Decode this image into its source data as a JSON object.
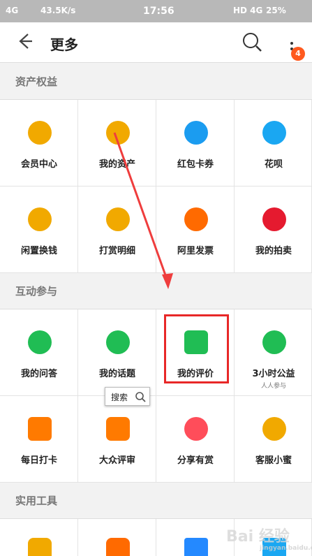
{
  "status_bar": {
    "signal": "4G",
    "speed": "43.5K/s",
    "time": "17:56",
    "network": "HD 4G",
    "battery": "25%"
  },
  "header": {
    "title": "更多",
    "badge": "4"
  },
  "sections": [
    {
      "title": "资产权益",
      "items": [
        {
          "label": "会员中心",
          "icon": "member-center-icon",
          "color": "#f1a900"
        },
        {
          "label": "我的资产",
          "icon": "assets-icon",
          "color": "#f1a900"
        },
        {
          "label": "红包卡券",
          "icon": "coupon-icon",
          "color": "#1b9cf0"
        },
        {
          "label": "花呗",
          "icon": "huabei-icon",
          "color": "#1aa7f2"
        },
        {
          "label": "闲置换钱",
          "icon": "money-icon",
          "color": "#f1a900"
        },
        {
          "label": "打赏明细",
          "icon": "tip-icon",
          "color": "#f1a900"
        },
        {
          "label": "阿里发票",
          "icon": "invoice-icon",
          "color": "#ff6a00"
        },
        {
          "label": "我的拍卖",
          "icon": "auction-icon",
          "color": "#e51a2f"
        }
      ]
    },
    {
      "title": "互动参与",
      "items": [
        {
          "label": "我的问答",
          "icon": "question-icon",
          "color": "#20bd54"
        },
        {
          "label": "我的话题",
          "icon": "topic-icon",
          "color": "#20bd54"
        },
        {
          "label": "我的评价",
          "icon": "comment-icon",
          "color": "#20bd54"
        },
        {
          "label": "3小时公益",
          "sub": "人人参与",
          "icon": "charity-icon",
          "color": "#20bd54"
        },
        {
          "label": "每日打卡",
          "icon": "calendar-icon",
          "color": "#ff7a00"
        },
        {
          "label": "大众评审",
          "icon": "review-icon",
          "color": "#ff7a00"
        },
        {
          "label": "分享有赏",
          "icon": "bag-icon",
          "color": "#ff4d5a"
        },
        {
          "label": "客服小蜜",
          "icon": "service-icon",
          "color": "#f1a900"
        }
      ]
    },
    {
      "title": "实用工具",
      "items": [
        {
          "label": "",
          "icon": "tool-icon",
          "color": "#f1a900"
        },
        {
          "label": "",
          "icon": "apps-icon",
          "color": "#ff6a00"
        },
        {
          "label": "",
          "icon": "cube-icon",
          "color": "#2489ff"
        },
        {
          "label": "",
          "icon": "calendar-blue-icon",
          "color": "#1aa7f2"
        }
      ]
    }
  ],
  "tooltip": {
    "text": "搜索"
  },
  "watermark": {
    "main": "Bai 经验",
    "sub": "jingyan.baidu.com"
  }
}
